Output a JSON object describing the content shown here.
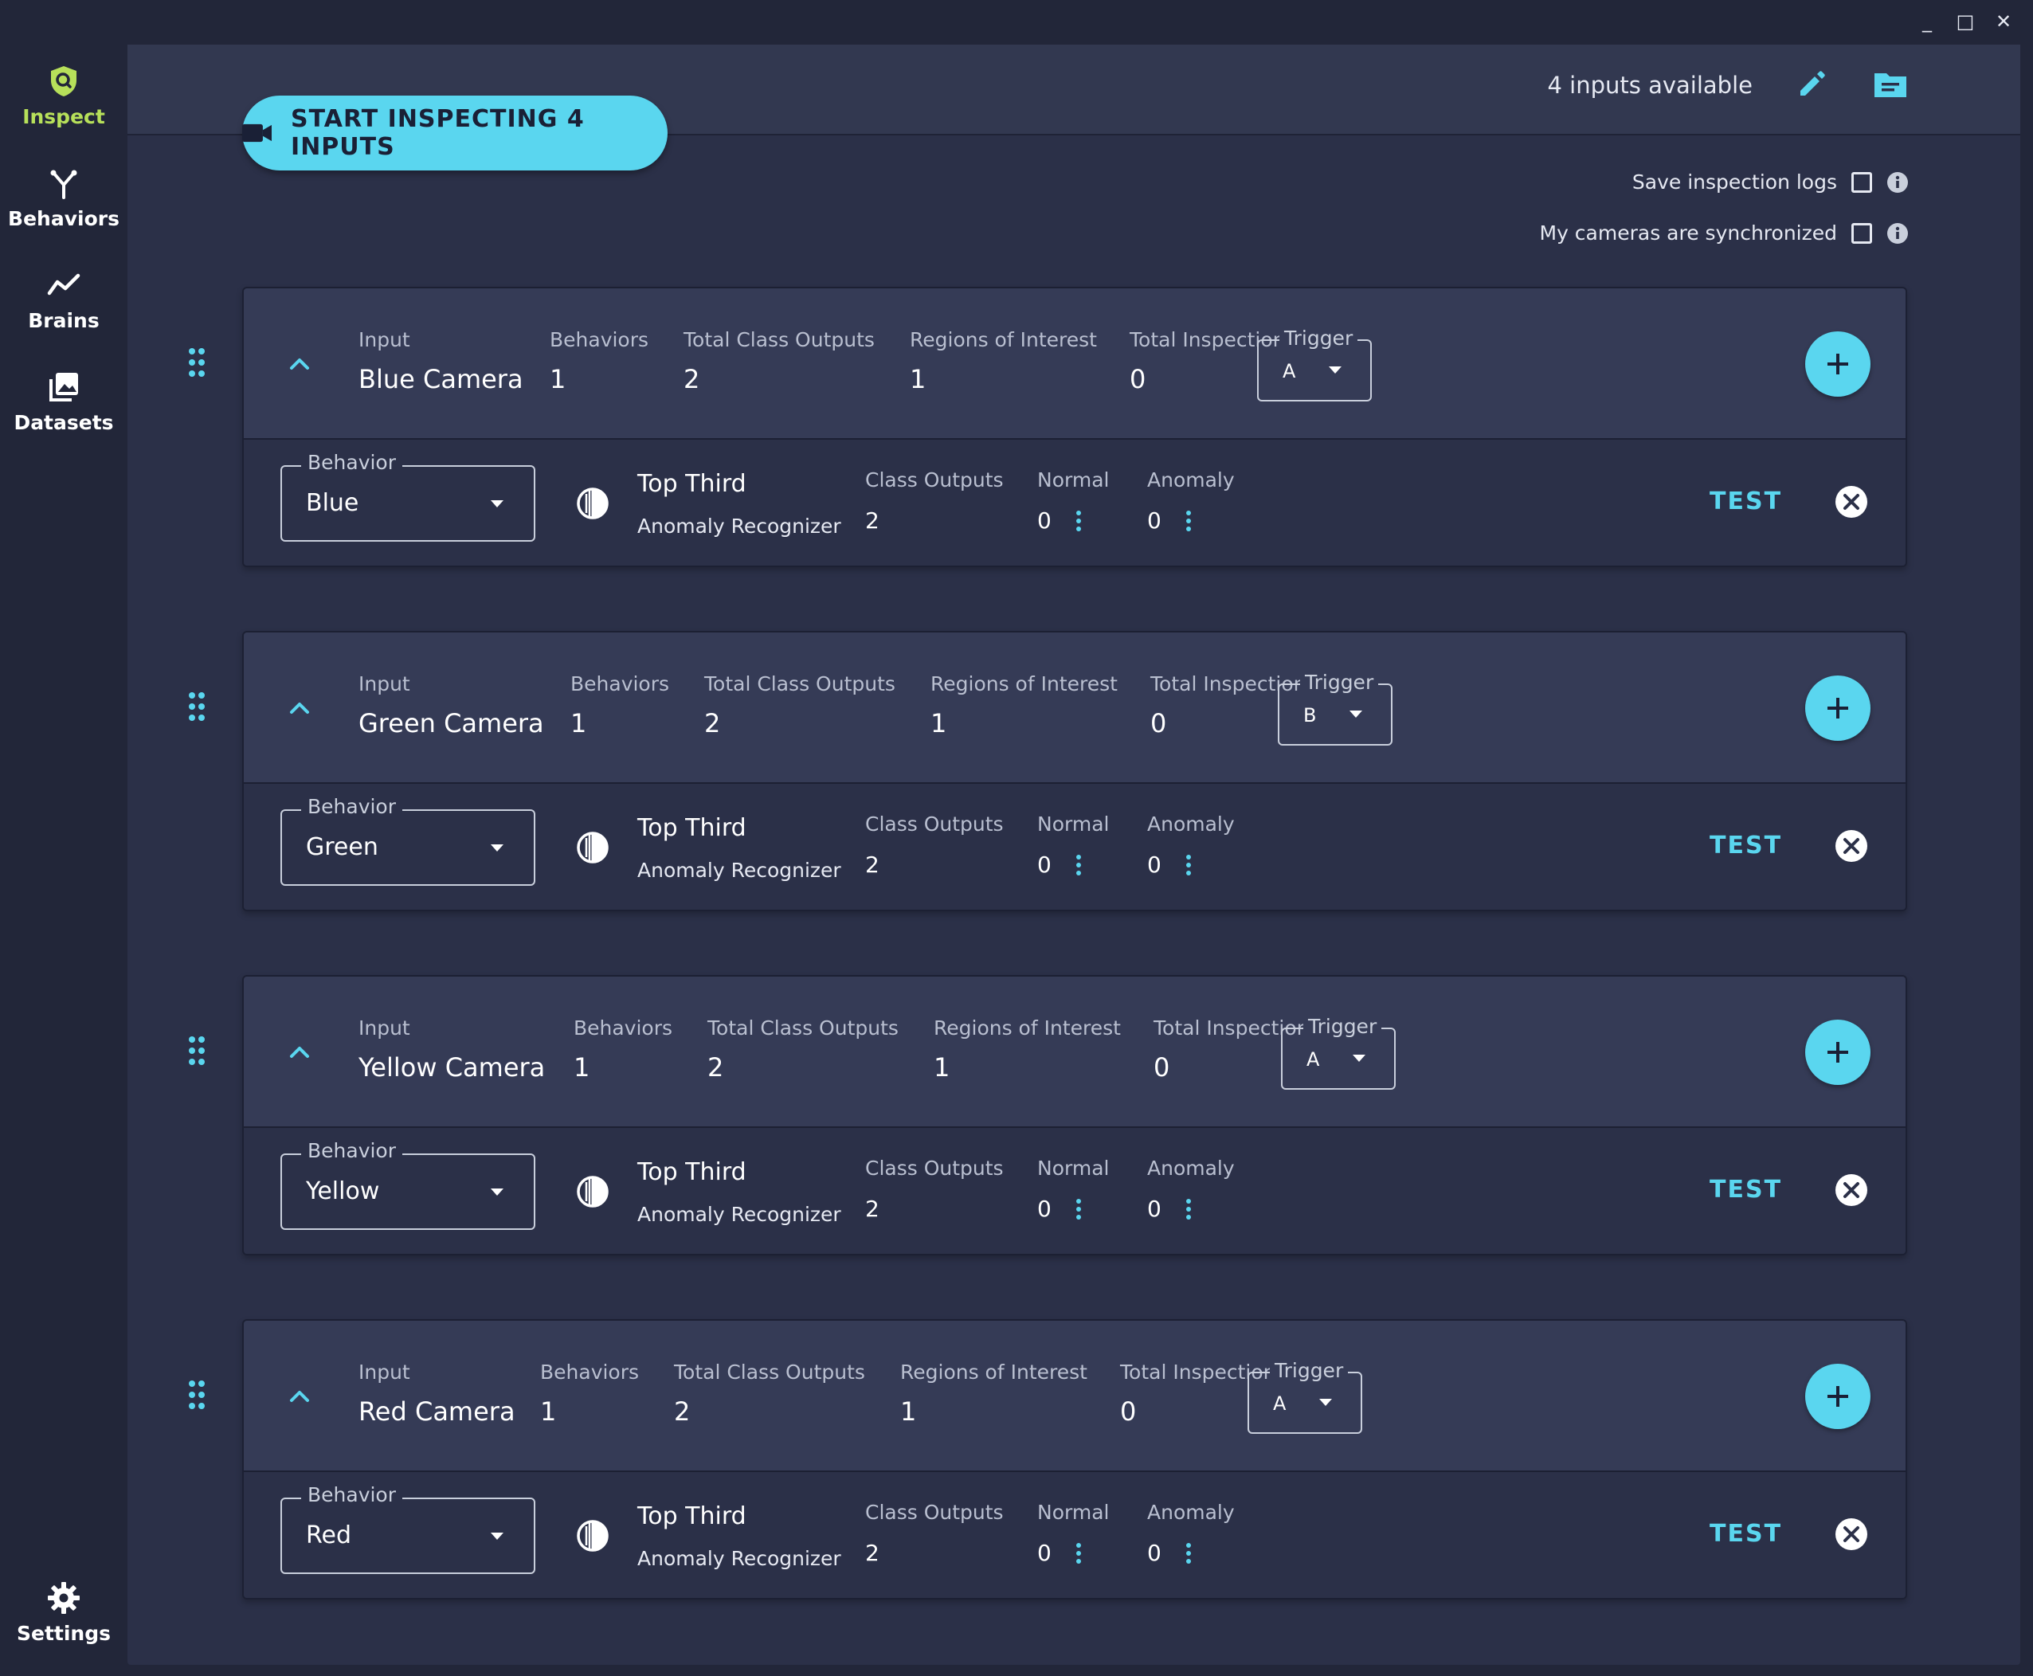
{
  "window": {
    "minimize": "_",
    "maximize": "□",
    "close": "✕"
  },
  "sidebar": {
    "items": [
      {
        "label": "Inspect",
        "icon": "shield-search-icon",
        "active": true
      },
      {
        "label": "Behaviors",
        "icon": "fork-icon",
        "active": false
      },
      {
        "label": "Brains",
        "icon": "line-chart-icon",
        "active": false
      },
      {
        "label": "Datasets",
        "icon": "image-stack-icon",
        "active": false
      }
    ],
    "settings_label": "Settings"
  },
  "header": {
    "start_button_label": "START INSPECTING 4 INPUTS",
    "inputs_available": "4 inputs available",
    "save_logs_label": "Save inspection logs",
    "synchronized_label": "My cameras are synchronized"
  },
  "labels": {
    "input": "Input",
    "behaviors": "Behaviors",
    "total_class_outputs": "Total Class Outputs",
    "regions_of_interest": "Regions of Interest",
    "total_inspection_count": "Total Inspection Count",
    "trigger": "Trigger",
    "behavior": "Behavior",
    "class_outputs": "Class Outputs",
    "normal": "Normal",
    "anomaly": "Anomaly",
    "test": "TEST"
  },
  "cards": [
    {
      "input": "Blue Camera",
      "behaviors": "1",
      "total_class_outputs": "2",
      "regions_of_interest": "1",
      "total_inspection_count": "0",
      "trigger": "A",
      "behavior": "Blue",
      "brain_name": "Top Third",
      "brain_type": "Anomaly Recognizer",
      "class_outputs": "2",
      "normal": "0",
      "anomaly": "0"
    },
    {
      "input": "Green Camera",
      "behaviors": "1",
      "total_class_outputs": "2",
      "regions_of_interest": "1",
      "total_inspection_count": "0",
      "trigger": "B",
      "behavior": "Green",
      "brain_name": "Top Third",
      "brain_type": "Anomaly Recognizer",
      "class_outputs": "2",
      "normal": "0",
      "anomaly": "0"
    },
    {
      "input": "Yellow Camera",
      "behaviors": "1",
      "total_class_outputs": "2",
      "regions_of_interest": "1",
      "total_inspection_count": "0",
      "trigger": "A",
      "behavior": "Yellow",
      "brain_name": "Top Third",
      "brain_type": "Anomaly Recognizer",
      "class_outputs": "2",
      "normal": "0",
      "anomaly": "0"
    },
    {
      "input": "Red Camera",
      "behaviors": "1",
      "total_class_outputs": "2",
      "regions_of_interest": "1",
      "total_inspection_count": "0",
      "trigger": "A",
      "behavior": "Red",
      "brain_name": "Top Third",
      "brain_type": "Anomaly Recognizer",
      "class_outputs": "2",
      "normal": "0",
      "anomaly": "0"
    }
  ],
  "colors": {
    "accent": "#5ad6ef",
    "active_nav": "#b7e05a",
    "background": "#222639",
    "panel": "#2b3048"
  }
}
